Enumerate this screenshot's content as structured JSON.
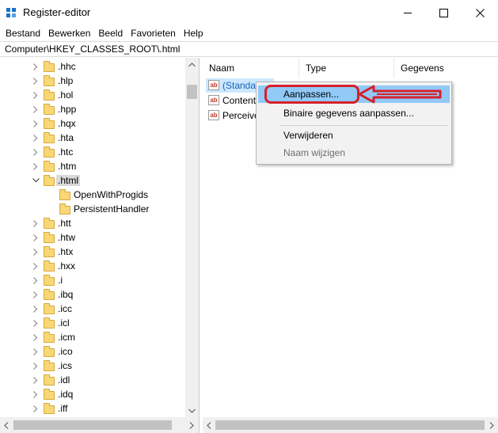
{
  "window": {
    "title": "Register-editor",
    "controls": {
      "minimize": "minimize",
      "maximize": "maximize",
      "close": "close"
    }
  },
  "menubar": {
    "items": [
      "Bestand",
      "Bewerken",
      "Beeld",
      "Favorieten",
      "Help"
    ]
  },
  "address": {
    "path": "Computer\\HKEY_CLASSES_ROOT\\.html"
  },
  "tree": {
    "items": [
      {
        "label": ".hhc",
        "level": 1,
        "expandable": true
      },
      {
        "label": ".hlp",
        "level": 1,
        "expandable": true
      },
      {
        "label": ".hol",
        "level": 1,
        "expandable": true
      },
      {
        "label": ".hpp",
        "level": 1,
        "expandable": true
      },
      {
        "label": ".hqx",
        "level": 1,
        "expandable": true
      },
      {
        "label": ".hta",
        "level": 1,
        "expandable": true
      },
      {
        "label": ".htc",
        "level": 1,
        "expandable": true
      },
      {
        "label": ".htm",
        "level": 1,
        "expandable": true
      },
      {
        "label": ".html",
        "level": 1,
        "expandable": true,
        "expanded": true,
        "selected": true
      },
      {
        "label": "OpenWithProgids",
        "level": 2,
        "expandable": false
      },
      {
        "label": "PersistentHandler",
        "level": 2,
        "expandable": false
      },
      {
        "label": ".htt",
        "level": 1,
        "expandable": true
      },
      {
        "label": ".htw",
        "level": 1,
        "expandable": true
      },
      {
        "label": ".htx",
        "level": 1,
        "expandable": true
      },
      {
        "label": ".hxx",
        "level": 1,
        "expandable": true
      },
      {
        "label": ".i",
        "level": 1,
        "expandable": true
      },
      {
        "label": ".ibq",
        "level": 1,
        "expandable": true
      },
      {
        "label": ".icc",
        "level": 1,
        "expandable": true
      },
      {
        "label": ".icl",
        "level": 1,
        "expandable": true
      },
      {
        "label": ".icm",
        "level": 1,
        "expandable": true
      },
      {
        "label": ".ico",
        "level": 1,
        "expandable": true
      },
      {
        "label": ".ics",
        "level": 1,
        "expandable": true
      },
      {
        "label": ".idl",
        "level": 1,
        "expandable": true
      },
      {
        "label": ".idq",
        "level": 1,
        "expandable": true
      },
      {
        "label": ".iff",
        "level": 1,
        "expandable": true
      }
    ]
  },
  "values": {
    "columns": {
      "name": "Naam",
      "type": "Type",
      "data": "Gegevens"
    },
    "rows": [
      {
        "name": "(Standaard)",
        "icon": "string-value-icon",
        "selected": true
      },
      {
        "name": "Content",
        "icon": "string-value-icon"
      },
      {
        "name": "Perceive",
        "icon": "string-value-icon"
      }
    ]
  },
  "context_menu": {
    "items": {
      "modify": "Aanpassen...",
      "modify_binary": "Binaire gegevens aanpassen...",
      "delete": "Verwijderen",
      "rename": "Naam wijzigen"
    },
    "highlighted": "modify",
    "disabled": [
      "rename"
    ]
  },
  "annotation": {
    "color": "#d6202a",
    "target": "modify"
  },
  "colors": {
    "folder": "#f8d775",
    "menu_highlight": "#91c9f7",
    "tree_selection": "#d9d9d9",
    "annotation": "#d6202a"
  }
}
